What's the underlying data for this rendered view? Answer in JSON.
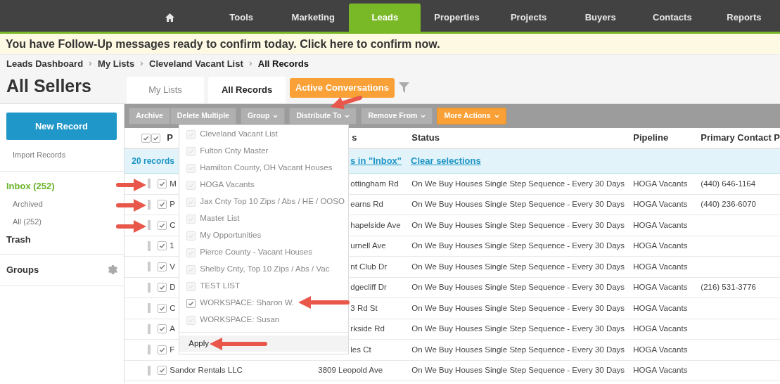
{
  "nav": {
    "items": [
      {
        "kind": "home",
        "selected": false
      },
      {
        "kind": "text",
        "label": "Tools",
        "selected": false
      },
      {
        "kind": "text",
        "label": "Marketing",
        "selected": false
      },
      {
        "kind": "text",
        "label": "Leads",
        "selected": true
      },
      {
        "kind": "text",
        "label": "Properties",
        "selected": false
      },
      {
        "kind": "text",
        "label": "Projects",
        "selected": false
      },
      {
        "kind": "text",
        "label": "Buyers",
        "selected": false
      },
      {
        "kind": "text",
        "label": "Contacts",
        "selected": false
      },
      {
        "kind": "text",
        "label": "Reports",
        "selected": false
      }
    ]
  },
  "banner": "You have Follow-Up messages ready to confirm today. Click here to confirm now.",
  "breadcrumb": [
    "Leads Dashboard",
    "My Lists",
    "Cleveland Vacant List",
    "All Records"
  ],
  "page_title": "All Sellers",
  "view_tabs": [
    {
      "label": "My Lists",
      "kind": "plain",
      "selected": false
    },
    {
      "label": "All Records",
      "kind": "plain",
      "selected": true
    },
    {
      "label": "Active Conversations",
      "kind": "accent",
      "selected": false
    }
  ],
  "sidebar": {
    "new_button": "New Record",
    "import_link": "Import Records",
    "items": [
      {
        "label": "Inbox (252)",
        "kind": "main",
        "selected": true
      },
      {
        "label": "Archived",
        "kind": "sub",
        "selected": false
      },
      {
        "label": "All (252)",
        "kind": "sub",
        "selected": false
      },
      {
        "label": "Trash",
        "kind": "main",
        "selected": false
      }
    ],
    "groups": "Groups"
  },
  "toolbar": [
    {
      "label": "Archive",
      "kind": "grey",
      "dropdown": false
    },
    {
      "label": "Delete Multiple",
      "kind": "grey",
      "dropdown": false
    },
    {
      "label": "Group",
      "kind": "grey",
      "dropdown": true
    },
    {
      "label": "Distribute To",
      "kind": "grey",
      "dropdown": true
    },
    {
      "label": "Remove From",
      "kind": "grey",
      "dropdown": true
    },
    {
      "label": "More Actions",
      "kind": "orange",
      "dropdown": true
    }
  ],
  "table": {
    "columns": [
      "P",
      "s",
      "Status",
      "Pipeline",
      "Primary Contact P"
    ],
    "select_all": {
      "checked": true
    },
    "selection_bar": {
      "count": "20 records",
      "link": "s in \"Inbox\"",
      "clear": "Clear selections"
    },
    "rows": [
      {
        "checked": true,
        "partly_hidden": true,
        "name": "M",
        "address": "ottingham Rd",
        "status": "On We Buy Houses Single Step Sequence - Every 30 Days",
        "pipeline": "HOGA Vacants",
        "phone": "(440) 646-1164"
      },
      {
        "checked": true,
        "partly_hidden": true,
        "name": "P",
        "address": "earns Rd",
        "status": "On We Buy Houses Single Step Sequence - Every 30 Days",
        "pipeline": "HOGA Vacants",
        "phone": "(440) 236-6070"
      },
      {
        "checked": true,
        "partly_hidden": true,
        "name": "C",
        "address": "hapelside Ave",
        "status": "On We Buy Houses Single Step Sequence - Every 30 Days",
        "pipeline": "HOGA Vacants"
      },
      {
        "checked": true,
        "partly_hidden": true,
        "name": "1",
        "address": "urnell Ave",
        "status": "On We Buy Houses Single Step Sequence - Every 30 Days",
        "pipeline": "HOGA Vacants"
      },
      {
        "checked": true,
        "partly_hidden": true,
        "name": "V",
        "address": "nt Club Dr",
        "status": "On We Buy Houses Single Step Sequence - Every 30 Days",
        "pipeline": "HOGA Vacants"
      },
      {
        "checked": true,
        "partly_hidden": true,
        "name": "D",
        "address": "dgecliff Dr",
        "status": "On We Buy Houses Single Step Sequence - Every 30 Days",
        "pipeline": "HOGA Vacants",
        "phone": "(216) 531-3776"
      },
      {
        "checked": true,
        "partly_hidden": true,
        "name": "C",
        "address": "3 Rd St",
        "status": "On We Buy Houses Single Step Sequence - Every 30 Days",
        "pipeline": "HOGA Vacants"
      },
      {
        "checked": true,
        "partly_hidden": true,
        "name": "A",
        "address": "rkside Rd",
        "status": "On We Buy Houses Single Step Sequence - Every 30 Days",
        "pipeline": "HOGA Vacants"
      },
      {
        "checked": true,
        "partly_hidden": true,
        "name": "F",
        "address": "les Ct",
        "status": "On We Buy Houses Single Step Sequence - Every 30 Days",
        "pipeline": "HOGA Vacants"
      },
      {
        "checked": true,
        "partly_hidden": false,
        "name": "Sandor Rentals LLC",
        "address": "3809 Leopold Ave",
        "status": "On We Buy Houses Single Step Sequence - Every 30 Days",
        "pipeline": "HOGA Vacants"
      }
    ]
  },
  "distribute_menu": {
    "items": [
      {
        "label": "Cleveland Vacant List",
        "checked": false
      },
      {
        "label": "Fulton Cnty Master",
        "checked": false
      },
      {
        "label": "Hamilton County, OH Vacant Houses",
        "checked": false
      },
      {
        "label": "HOGA Vacants",
        "checked": false
      },
      {
        "label": "Jax Cnty Top 10 Zips / Abs / HE / OOSO",
        "checked": false
      },
      {
        "label": "Master List",
        "checked": false
      },
      {
        "label": "My Opportunities",
        "checked": false
      },
      {
        "label": "Pierce County - Vacant Houses",
        "checked": false
      },
      {
        "label": "Shelby Cnty, Top 10 Zips / Abs / Vac",
        "checked": false
      },
      {
        "label": "TEST LIST",
        "checked": false
      },
      {
        "label": "WORKSPACE: Sharon W.",
        "checked": true
      },
      {
        "label": "WORKSPACE: Susan",
        "checked": false
      }
    ],
    "apply": "Apply"
  }
}
